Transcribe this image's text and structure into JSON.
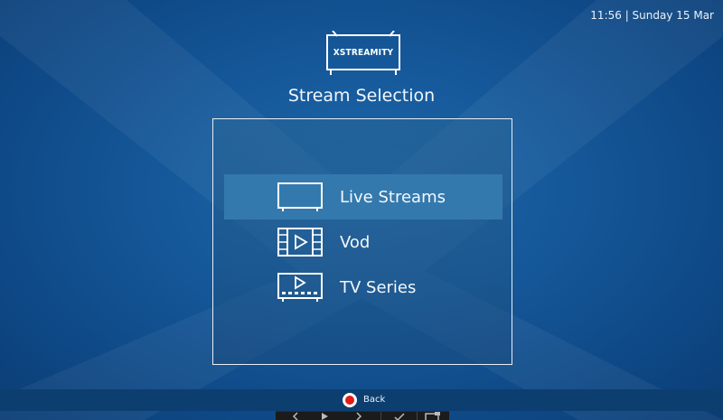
{
  "status_bar": {
    "clock": "11:56 | Sunday 15 Mar"
  },
  "logo": {
    "text": "XSTREAMITY",
    "icon": "tv-logo-icon"
  },
  "page": {
    "title": "Stream Selection"
  },
  "menu": {
    "items": [
      {
        "label": "Live Streams",
        "icon": "tv-icon",
        "selected": true
      },
      {
        "label": "Vod",
        "icon": "film-play-icon",
        "selected": false
      },
      {
        "label": "TV Series",
        "icon": "tv-series-icon",
        "selected": false
      }
    ]
  },
  "footer": {
    "back_label": "Back",
    "back_button_color": "#e31b1b"
  },
  "colors": {
    "background": "#165a9c",
    "selected_item": "#3479ad",
    "text": "#f4f8fc"
  }
}
